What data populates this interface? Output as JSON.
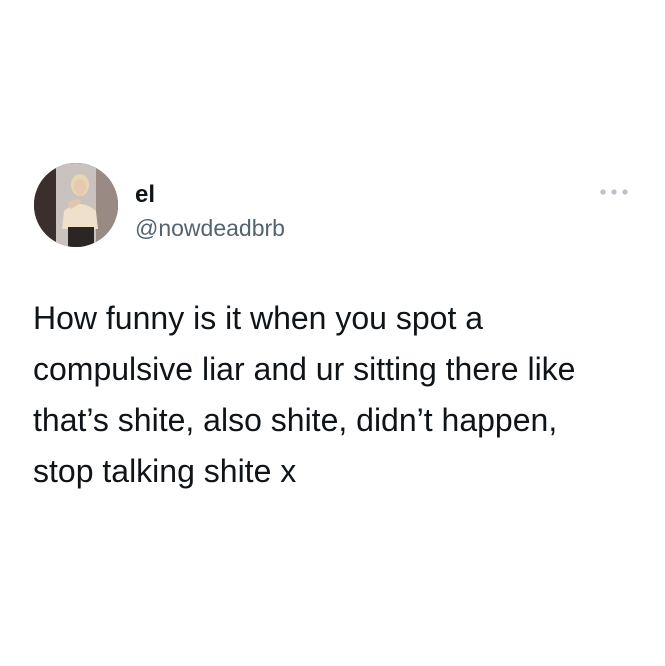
{
  "tweet": {
    "author": {
      "display_name": "el",
      "handle": "@nowdeadbrb"
    },
    "icons": {
      "avatar": "profile-photo",
      "more": "more-dots-icon"
    },
    "text": "How funny is it when you spot a\ncompulsive liar and ur sitting there like\nthat’s shite, also shite, didn’t happen,\nstop talking shite x"
  },
  "colors": {
    "background": "#ffffff",
    "text_primary": "#0f1419",
    "text_secondary": "#536471",
    "more_icon": "#b8c2cc"
  }
}
